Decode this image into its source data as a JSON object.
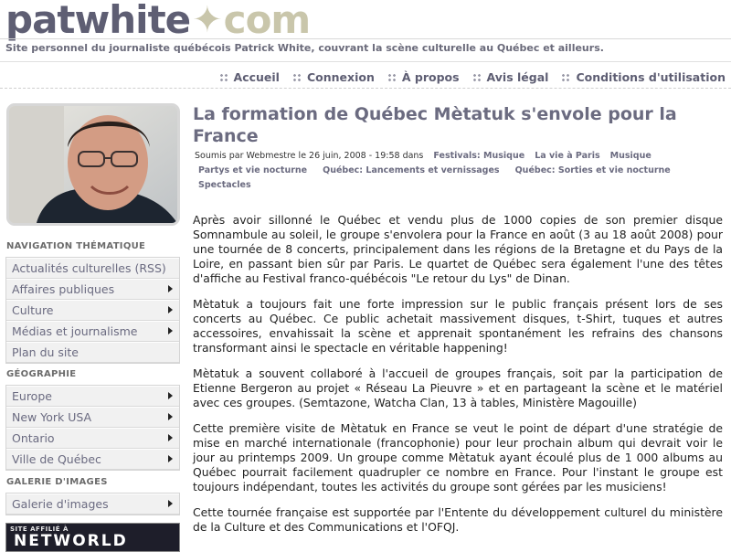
{
  "header": {
    "logo_left": "patwhite",
    "logo_star": "✦",
    "logo_right": "com",
    "tagline": "Site personnel du journaliste québécois Patrick White, couvrant la scène culturelle au Québec et ailleurs."
  },
  "topnav": [
    "Accueil",
    "Connexion",
    "À propos",
    "Avis légal",
    "Conditions d'utilisation"
  ],
  "sidebar": {
    "nav_title": "NAVIGATION THÉMATIQUE",
    "nav_items": [
      {
        "label": "Actualités culturelles (RSS)",
        "arrow": false
      },
      {
        "label": "Affaires publiques",
        "arrow": true
      },
      {
        "label": "Culture",
        "arrow": true
      },
      {
        "label": "Médias et journalisme",
        "arrow": true
      },
      {
        "label": "Plan du site",
        "arrow": false
      }
    ],
    "geo_title": "GÉOGRAPHIE",
    "geo_items": [
      {
        "label": "Europe",
        "arrow": true
      },
      {
        "label": "New York USA",
        "arrow": true
      },
      {
        "label": "Ontario",
        "arrow": true
      },
      {
        "label": "Ville de Québec",
        "arrow": true
      }
    ],
    "gallery_title": "GALERIE D'IMAGES",
    "gallery_items": [
      {
        "label": "Galerie d'images",
        "arrow": true
      }
    ],
    "badge_top": "SITE AFFILIÉ À",
    "badge_text": "NETWORLD"
  },
  "article": {
    "title": "La formation de Québec Mètatuk s'envole pour la France",
    "meta_prefix": "Soumis par Webmestre le 26 juin, 2008 - 19:58 dans",
    "tags": [
      "Festivals: Musique",
      "La vie à Paris",
      "Musique",
      "Partys et vie nocturne",
      "Québec: Lancements et vernissages",
      "Québec: Sorties et vie nocturne",
      "Spectacles"
    ],
    "paragraphs": [
      "Après avoir sillonné le Québec et vendu plus de 1000 copies de son premier disque Somnambule au soleil, le groupe s'envolera pour la France en août (3 au 18 août 2008) pour une tournée de 8 concerts, principalement dans les régions de la Bretagne et du Pays de la Loire, en passant bien sûr par Paris. Le quartet de Québec sera également l'une des têtes d'affiche au Festival franco-québécois \"Le retour du Lys\" de Dinan.",
      "Mètatuk a toujours fait une forte impression sur le public français présent lors de ses concerts au Québec. Ce public achetait massivement disques, t-Shirt, tuques et autres accessoires, envahissait la scène et apprenait spontanément les refrains des chansons transformant ainsi le spectacle en véritable happening!",
      "Mètatuk a souvent collaboré à l'accueil de groupes français, soit par la participation de Etienne Bergeron au projet « Réseau La Pieuvre » et en partageant la scène et le matériel avec ces groupes. (Semtazone, Watcha Clan, 13 à tables, Ministère Magouille)",
      "Cette première visite de Mètatuk en France se veut le point de départ d'une stratégie de mise en marché internationale (francophonie) pour leur prochain album qui devrait voir le jour au printemps 2009. Un groupe comme Mètatuk ayant écoulé plus de 1 000 albums au Québec pourrait facilement quadrupler ce nombre en France. Pour l'instant le groupe est toujours indépendant, toutes les activités du groupe sont gérées par les musiciens!",
      "Cette tournée française est supportée par l'Entente du développement culturel du ministère de la Culture et des Communications et l'OFQJ."
    ]
  }
}
